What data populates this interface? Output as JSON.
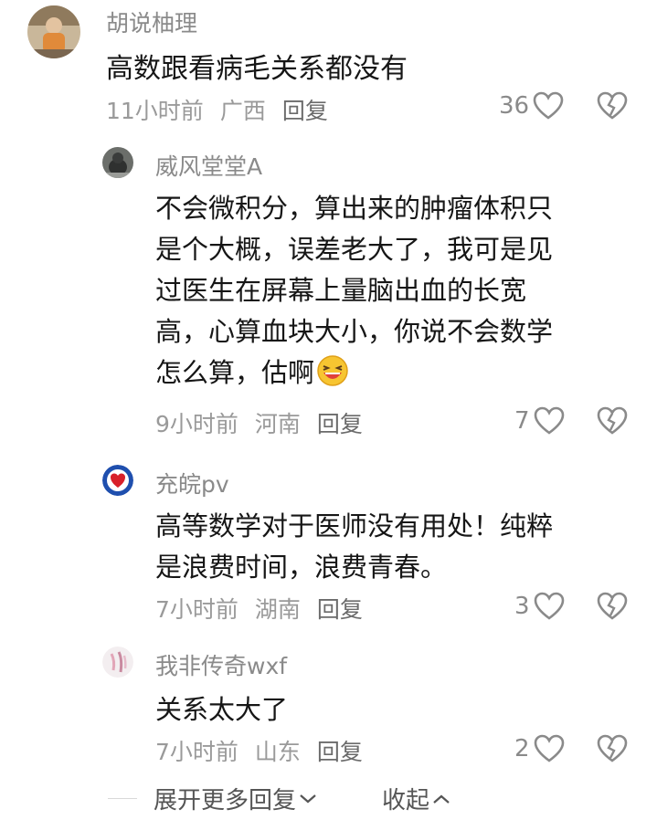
{
  "comments": [
    {
      "username": "胡说柚理",
      "lines": [
        "高数跟看病毛关系都没有"
      ],
      "time": "11小时前",
      "location": "广西",
      "reply": "回复",
      "likes": "36"
    },
    {
      "username": "威风堂堂A",
      "lines": [
        "不会微积分，算出来的肿瘤体积只",
        "是个大概，误差老大了，我可是见",
        "过医生在屏幕上量脑出血的长宽",
        "高，心算血块大小，你说不会数学",
        "怎么算，估啊"
      ],
      "time": "9小时前",
      "location": "河南",
      "reply": "回复",
      "likes": "7"
    },
    {
      "username": "充皖pv",
      "lines": [
        "高等数学对于医师没有用处！纯粹",
        "是浪费时间，浪费青春。"
      ],
      "time": "7小时前",
      "location": "湖南",
      "reply": "回复",
      "likes": "3"
    },
    {
      "username": "我非传奇wxf",
      "lines": [
        "关系太大了"
      ],
      "time": "7小时前",
      "location": "山东",
      "reply": "回复",
      "likes": "2"
    }
  ],
  "footer": {
    "expand_label": "展开更多回复",
    "collapse_label": "收起"
  },
  "icons": {
    "like": "heart-outline-icon",
    "dislike": "broken-heart-icon",
    "emoji": "laughing-emoji-icon"
  },
  "colors": {
    "text": "#161616",
    "username": "#8a8a8a",
    "meta": "#9a9a9a"
  }
}
